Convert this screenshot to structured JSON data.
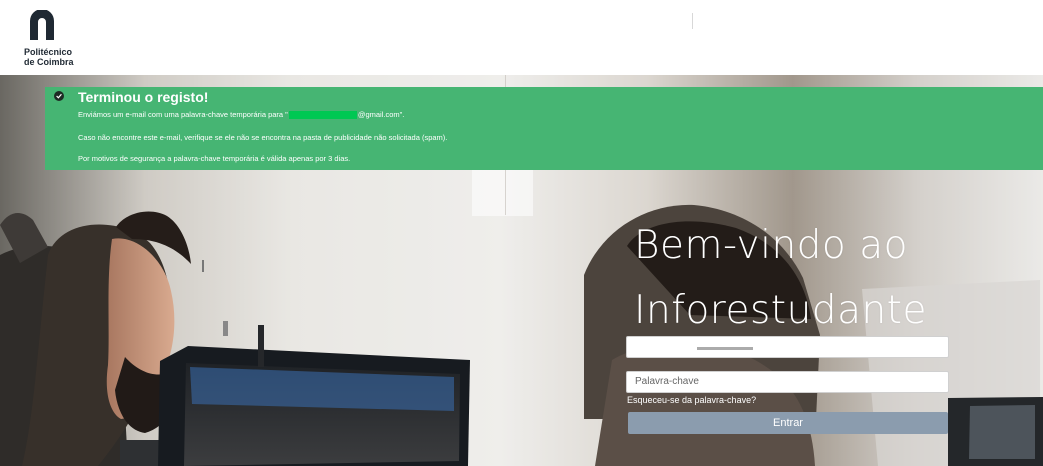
{
  "brand": {
    "line1": "Politécnico",
    "line2": "de Coimbra",
    "logo_icon": "arch-logo-icon",
    "color": "#1f2933"
  },
  "alert": {
    "icon": "check-circle-icon",
    "title": "Terminou o registo!",
    "line1_prefix": "Enviámos um e-mail com uma palavra-chave temporária para \"",
    "line1_suffix": "@gmail.com\".",
    "line2": "Caso não encontre este e-mail, verifique se ele não se encontra na pasta de publicidade não solicitada (spam).",
    "line3": "Por motivos de segurança a palavra-chave temporária é válida apenas por 3 dias.",
    "background": "#46b573"
  },
  "login": {
    "heading_line1": "Bem-vindo ao",
    "heading_line2": "Inforestudante",
    "password_placeholder": "Palavra-chave",
    "forgot_link": "Esqueceu-se da palavra-chave?",
    "submit_label": "Entrar",
    "submit_color": "#8b9cae"
  }
}
